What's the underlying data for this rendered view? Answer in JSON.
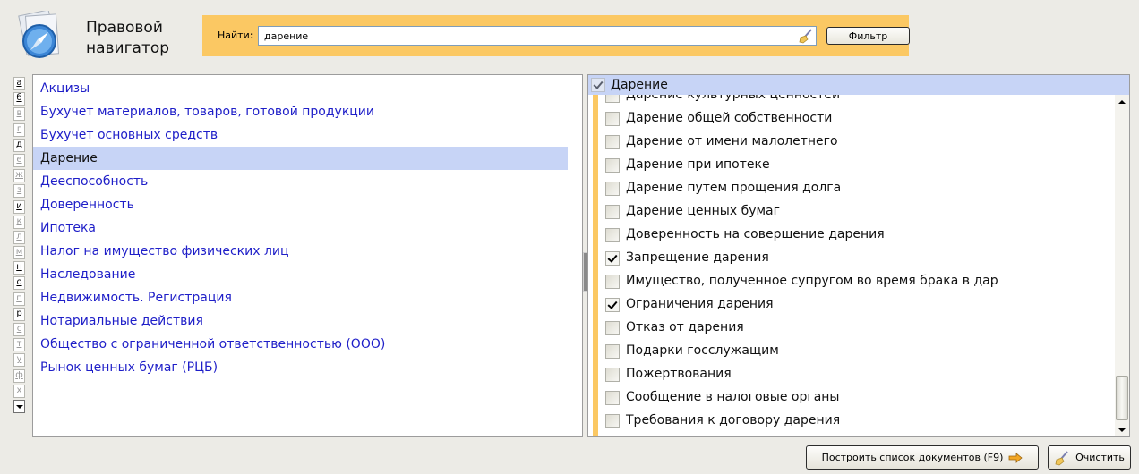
{
  "app": {
    "title_line1": "Правовой",
    "title_line2": "навигатор"
  },
  "search": {
    "label": "Найти:",
    "value": "дарение",
    "filter_label": "Фильтр"
  },
  "alphabet": [
    {
      "letter": "а",
      "active": true
    },
    {
      "letter": "б",
      "active": true
    },
    {
      "letter": "в",
      "active": false
    },
    {
      "letter": "г",
      "active": false
    },
    {
      "letter": "д",
      "active": true
    },
    {
      "letter": "е",
      "active": false
    },
    {
      "letter": "ж",
      "active": false
    },
    {
      "letter": "з",
      "active": false
    },
    {
      "letter": "и",
      "active": true
    },
    {
      "letter": "к",
      "active": false
    },
    {
      "letter": "л",
      "active": false
    },
    {
      "letter": "м",
      "active": false
    },
    {
      "letter": "н",
      "active": true
    },
    {
      "letter": "о",
      "active": true
    },
    {
      "letter": "п",
      "active": false
    },
    {
      "letter": "р",
      "active": true
    },
    {
      "letter": "с",
      "active": false
    },
    {
      "letter": "т",
      "active": false
    },
    {
      "letter": "у",
      "active": false
    },
    {
      "letter": "ф",
      "active": false
    },
    {
      "letter": "х",
      "active": false
    }
  ],
  "topics": [
    "Акцизы",
    "Бухучет материалов, товаров, готовой продукции",
    "Бухучет основных средств",
    "Дарение",
    "Дееспособность",
    "Доверенность",
    "Ипотека",
    "Налог на имущество физических лиц",
    "Наследование",
    "Недвижимость. Регистрация",
    "Нотариальные действия",
    "Общество с ограниченной ответственностью (ООО)",
    "Рынок ценных бумаг (РЦБ)"
  ],
  "selected_topic": "Дарение",
  "right_panel": {
    "header": "Дарение",
    "items": [
      {
        "label": "Дарение культурных ценностей",
        "checked": false
      },
      {
        "label": "Дарение общей собственности",
        "checked": false
      },
      {
        "label": "Дарение от имени малолетнего",
        "checked": false
      },
      {
        "label": "Дарение при ипотеке",
        "checked": false
      },
      {
        "label": "Дарение путем прощения долга",
        "checked": false
      },
      {
        "label": "Дарение ценных бумаг",
        "checked": false
      },
      {
        "label": "Доверенность на совершение дарения",
        "checked": false
      },
      {
        "label": "Запрещение дарения",
        "checked": true
      },
      {
        "label": "Имущество, полученное супругом во время брака в дар",
        "checked": false
      },
      {
        "label": "Ограничения дарения",
        "checked": true
      },
      {
        "label": "Отказ от дарения",
        "checked": false
      },
      {
        "label": "Подарки госслужащим",
        "checked": false
      },
      {
        "label": "Пожертвования",
        "checked": false
      },
      {
        "label": "Сообщение в налоговые органы",
        "checked": false
      },
      {
        "label": "Требования к договору дарения",
        "checked": false
      }
    ]
  },
  "buttons": {
    "build": "Построить список документов (F9)",
    "clear": "Очистить"
  },
  "colors": {
    "accent": "#fbc863",
    "selection": "#c7d4f6",
    "link": "#1e1ec8"
  }
}
